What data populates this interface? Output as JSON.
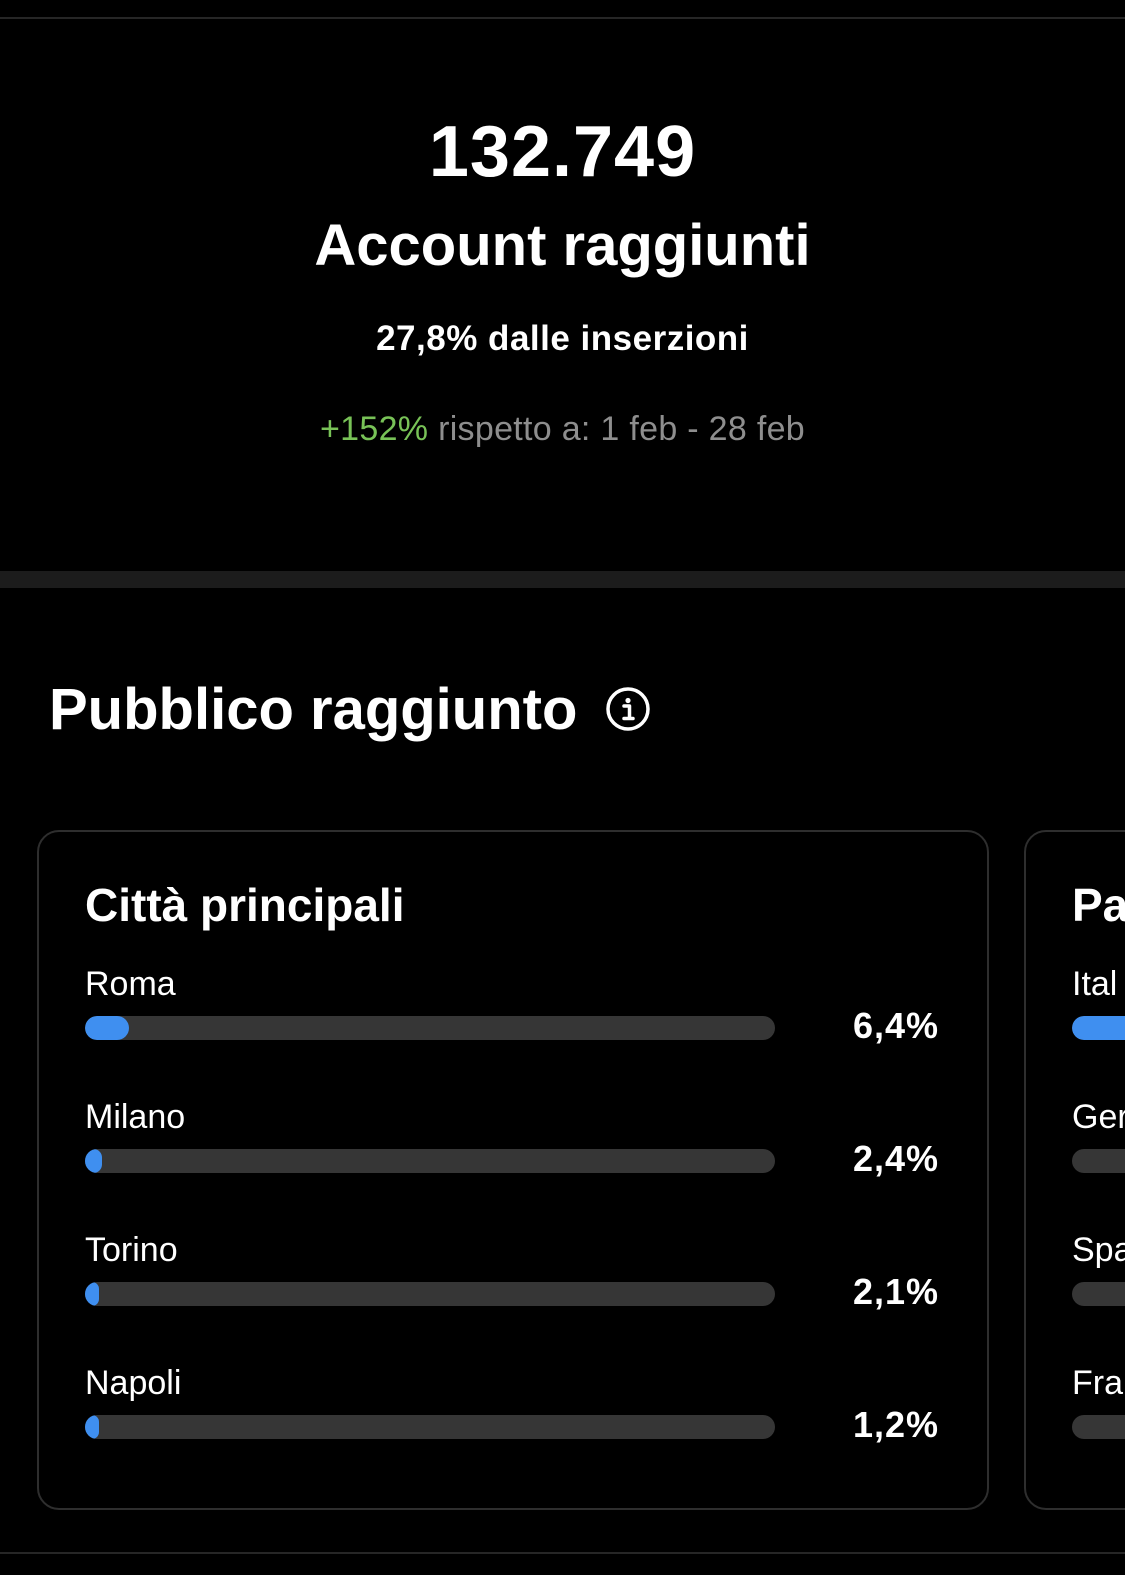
{
  "summary": {
    "value": "132.749",
    "label": "Account raggiunti",
    "ads_share": "27,8% dalle inserzioni",
    "change": "+152%",
    "compare_text": "rispetto a: 1 feb - 28 feb",
    "change_color": "#78c257"
  },
  "audience": {
    "title": "Pubblico raggiunto",
    "info_icon": "info-circle-icon"
  },
  "cities_card": {
    "title": "Città principali",
    "bar_color": "#3f8ff0",
    "rows": [
      {
        "label": "Roma",
        "value": "6,4%",
        "fraction": 0.064
      },
      {
        "label": "Milano",
        "value": "2,4%",
        "fraction": 0.024
      },
      {
        "label": "Torino",
        "value": "2,1%",
        "fraction": 0.021
      },
      {
        "label": "Napoli",
        "value": "1,2%",
        "fraction": 0.012
      }
    ]
  },
  "countries_card": {
    "title": "Pa",
    "rows": [
      {
        "label": "Ital",
        "fraction": 0.8
      },
      {
        "label": "Ger",
        "fraction": 0.0
      },
      {
        "label": "Spa",
        "fraction": 0.0
      },
      {
        "label": "Fra",
        "fraction": 0.0
      }
    ]
  }
}
